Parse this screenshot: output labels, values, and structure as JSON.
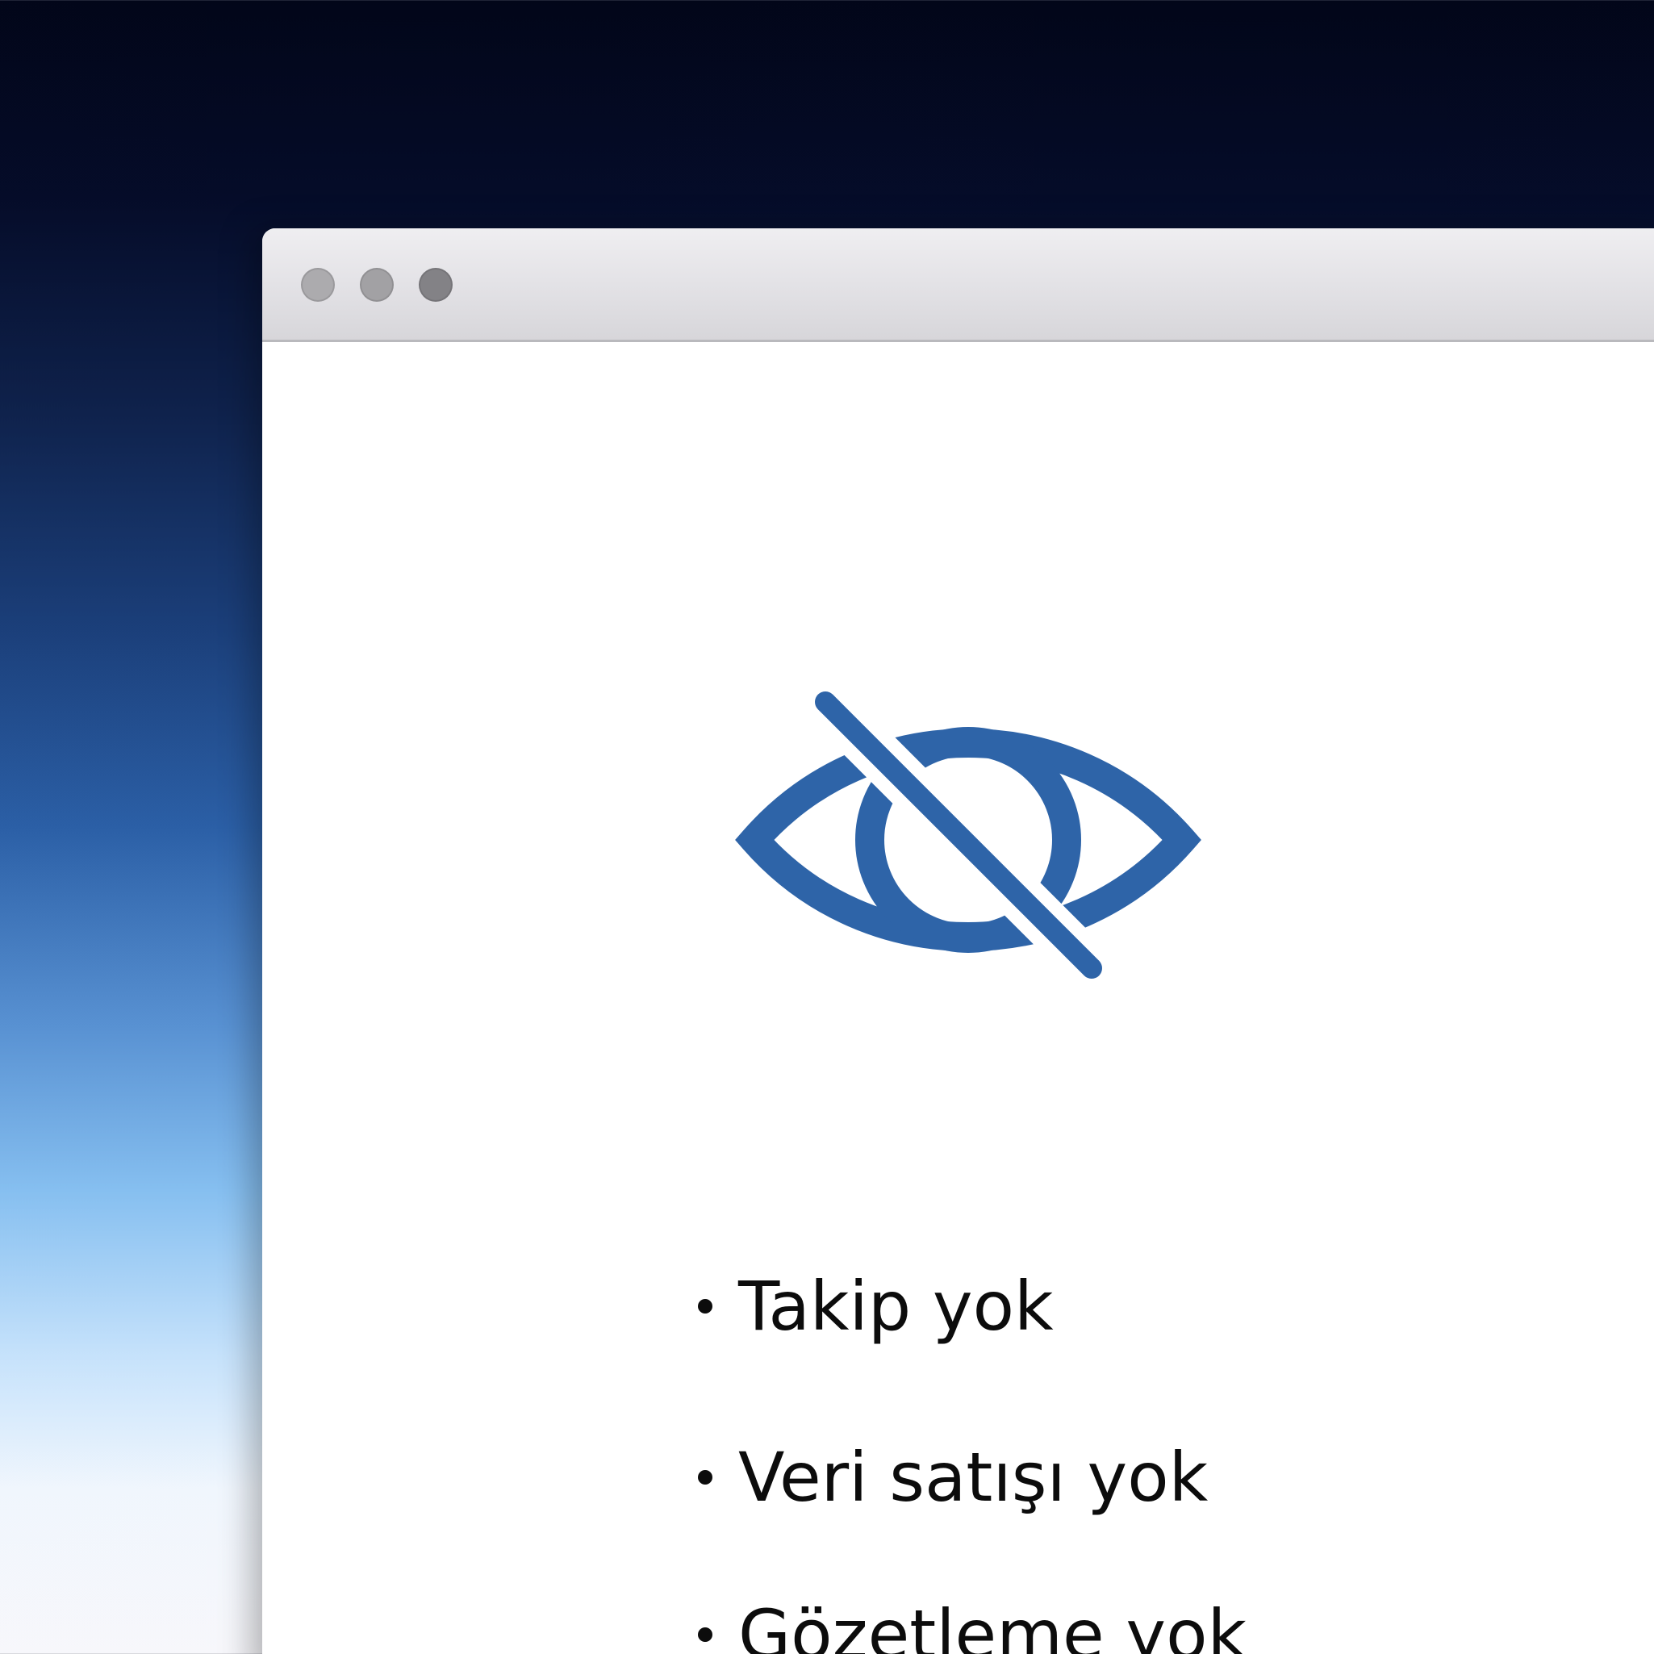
{
  "window": {
    "traffic_lights": [
      "close",
      "minimize",
      "zoom"
    ]
  },
  "icon": {
    "name": "eye-slash-icon",
    "color": "#2e64a8"
  },
  "features": [
    "Takip yok",
    "Veri satışı yok",
    "Gözetleme yok"
  ]
}
